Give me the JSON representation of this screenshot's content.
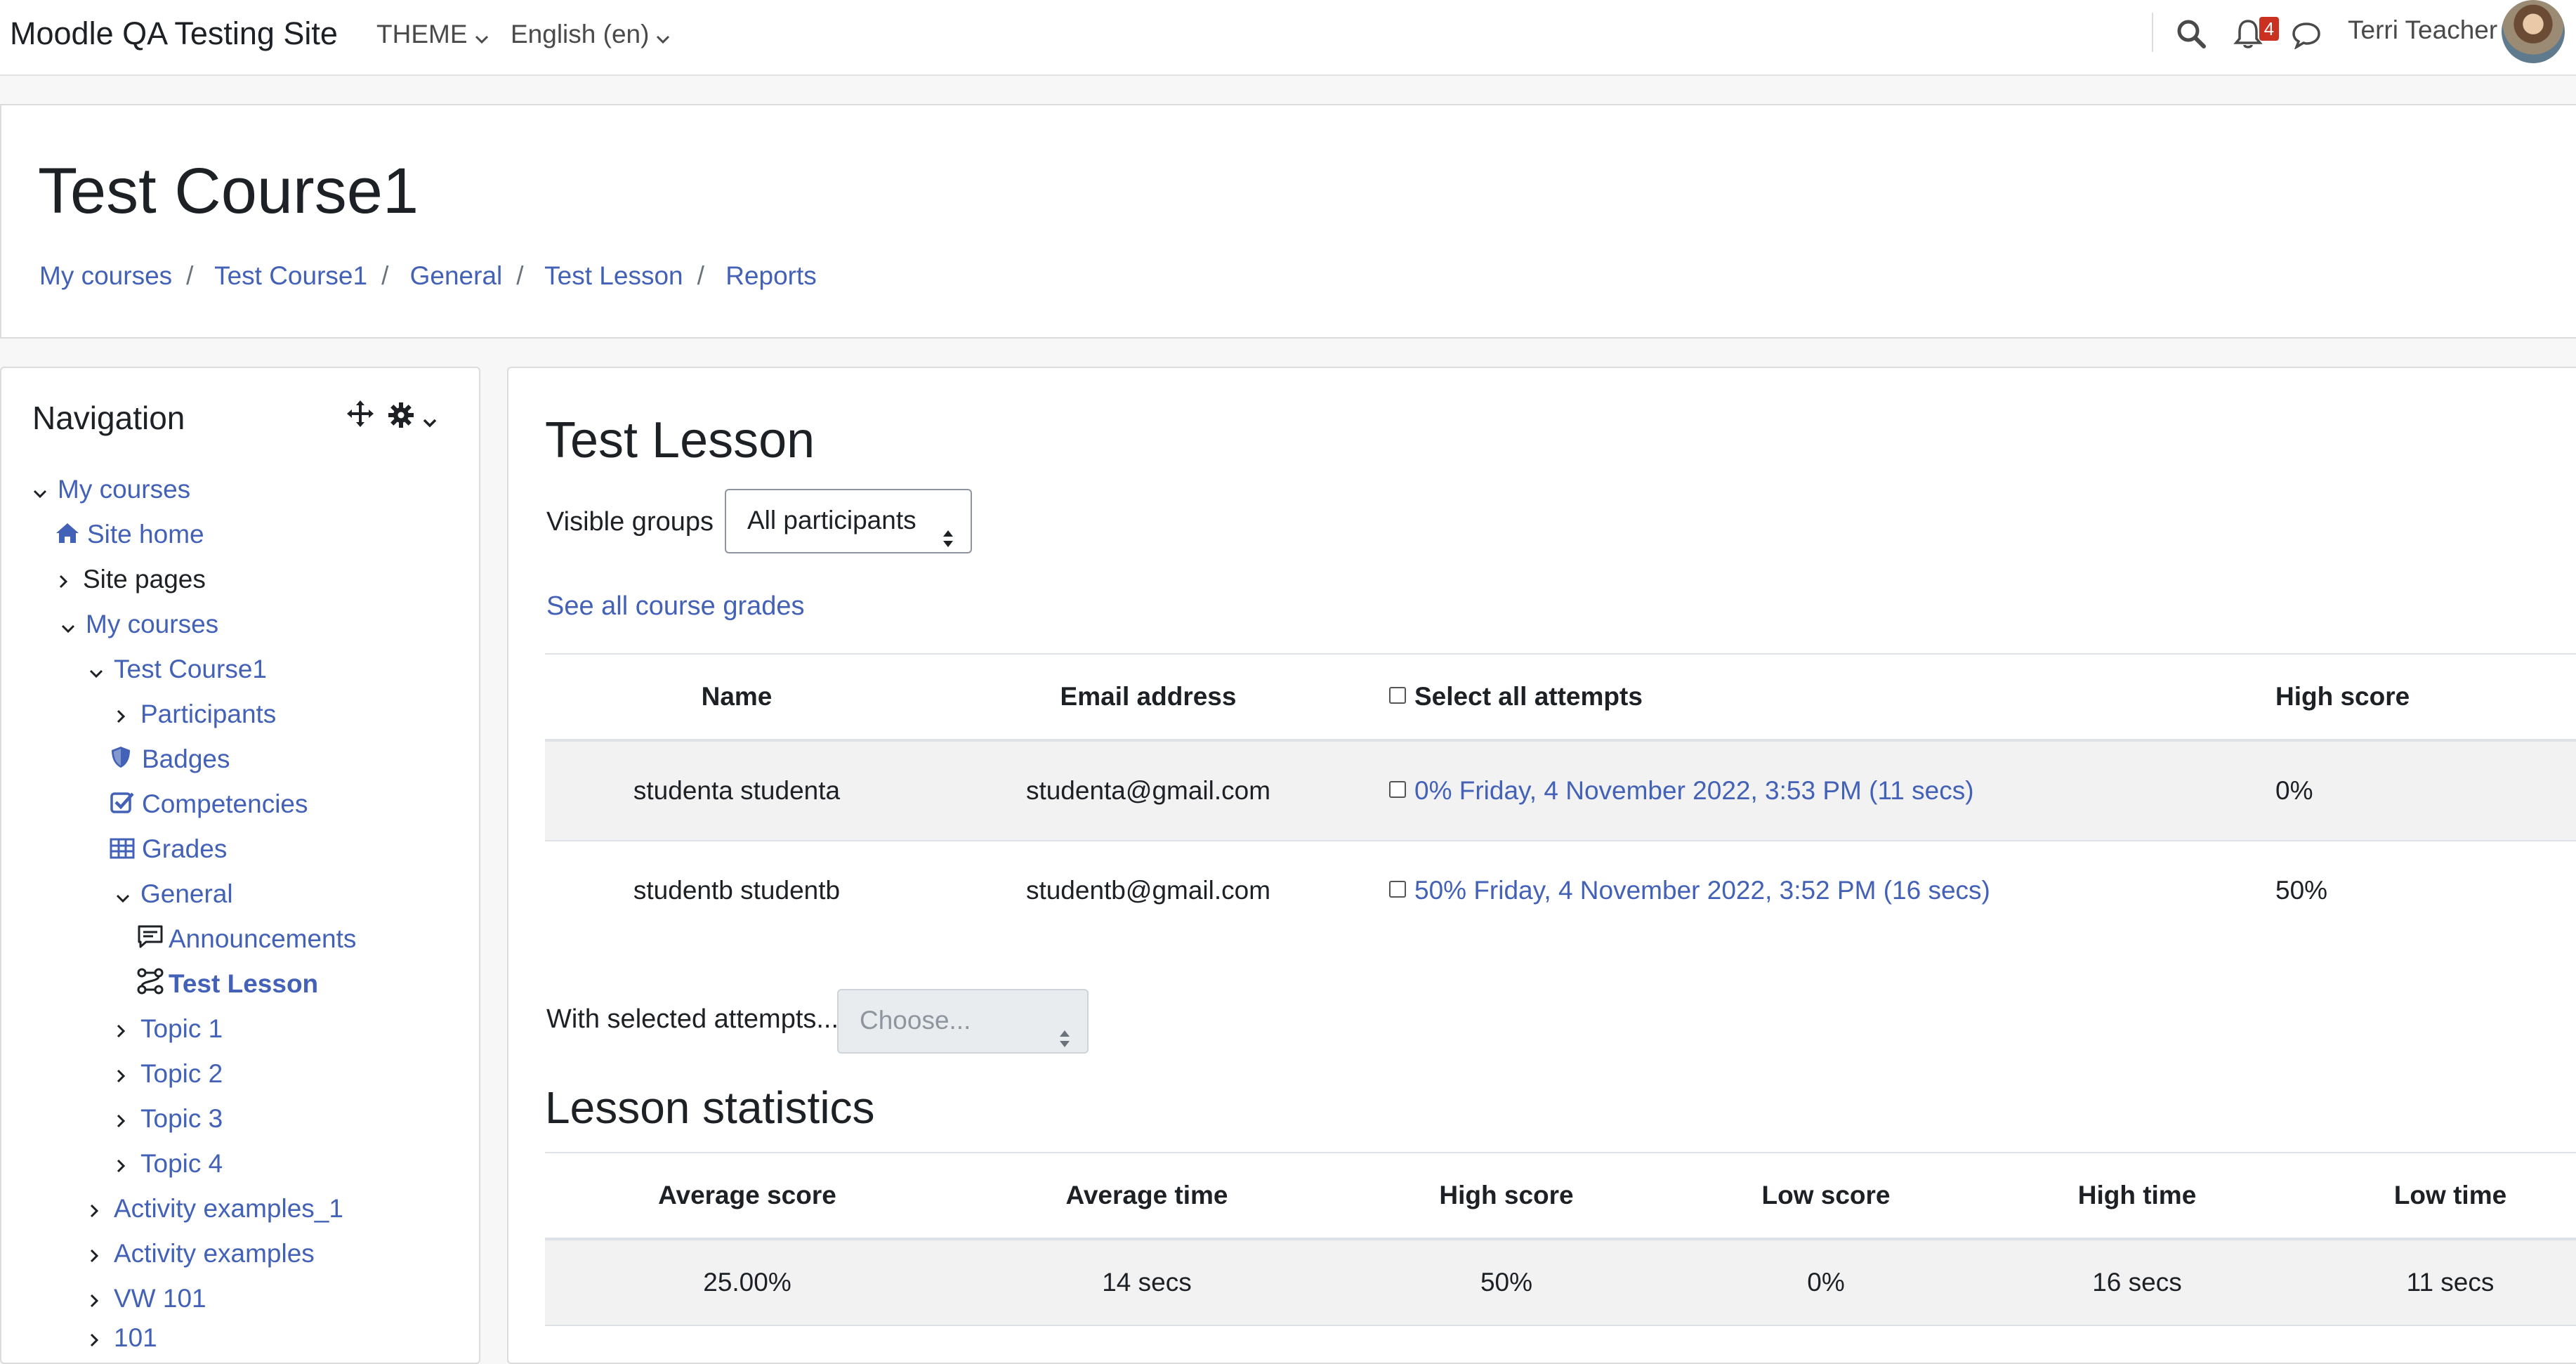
{
  "navbar": {
    "brand": "Moodle QA Testing Site",
    "theme_menu": "THEME",
    "language_menu": "English (en)",
    "notification_count": "4",
    "user_name": "Terri Teacher"
  },
  "header": {
    "course_title": "Test Course1",
    "breadcrumb": [
      "My courses",
      "Test Course1",
      "General",
      "Test Lesson",
      "Reports"
    ]
  },
  "navigation": {
    "title": "Navigation",
    "items": [
      {
        "label": "My courses"
      },
      {
        "label": "Site home"
      },
      {
        "label": "Site pages"
      },
      {
        "label": "My courses"
      },
      {
        "label": "Test Course1"
      },
      {
        "label": "Participants"
      },
      {
        "label": "Badges"
      },
      {
        "label": "Competencies"
      },
      {
        "label": "Grades"
      },
      {
        "label": "General"
      },
      {
        "label": "Announcements"
      },
      {
        "label": "Test Lesson"
      },
      {
        "label": "Topic 1"
      },
      {
        "label": "Topic 2"
      },
      {
        "label": "Topic 3"
      },
      {
        "label": "Topic 4"
      },
      {
        "label": "Activity examples_1"
      },
      {
        "label": "Activity examples"
      },
      {
        "label": "VW 101"
      },
      {
        "label": "101"
      }
    ]
  },
  "main": {
    "heading": "Test Lesson",
    "visible_groups_label": "Visible groups",
    "visible_groups_value": "All participants",
    "see_all_grades": "See all course grades",
    "attempts_table": {
      "headers": [
        "Name",
        "Email address",
        "Select all attempts",
        "High score"
      ],
      "rows": [
        {
          "name": "studenta studenta",
          "email": "studenta@gmail.com",
          "attempt": "0% Friday, 4 November 2022, 3:53 PM (11 secs)",
          "high_score": "0%"
        },
        {
          "name": "studentb studentb",
          "email": "studentb@gmail.com",
          "attempt": "50% Friday, 4 November 2022, 3:52 PM (16 secs)",
          "high_score": "50%"
        }
      ]
    },
    "with_selected_label": "With selected attempts...",
    "with_selected_value": "Choose...",
    "stats_heading": "Lesson statistics",
    "stats_table": {
      "headers": [
        "Average score",
        "Average time",
        "High score",
        "Low score",
        "High time",
        "Low time"
      ],
      "values": [
        "25.00%",
        "14 secs",
        "50%",
        "0%",
        "16 secs",
        "11 secs"
      ]
    }
  },
  "colors": {
    "link": "#4261b7",
    "badge": "#ca3120",
    "row_stripe": "#f2f2f2"
  }
}
